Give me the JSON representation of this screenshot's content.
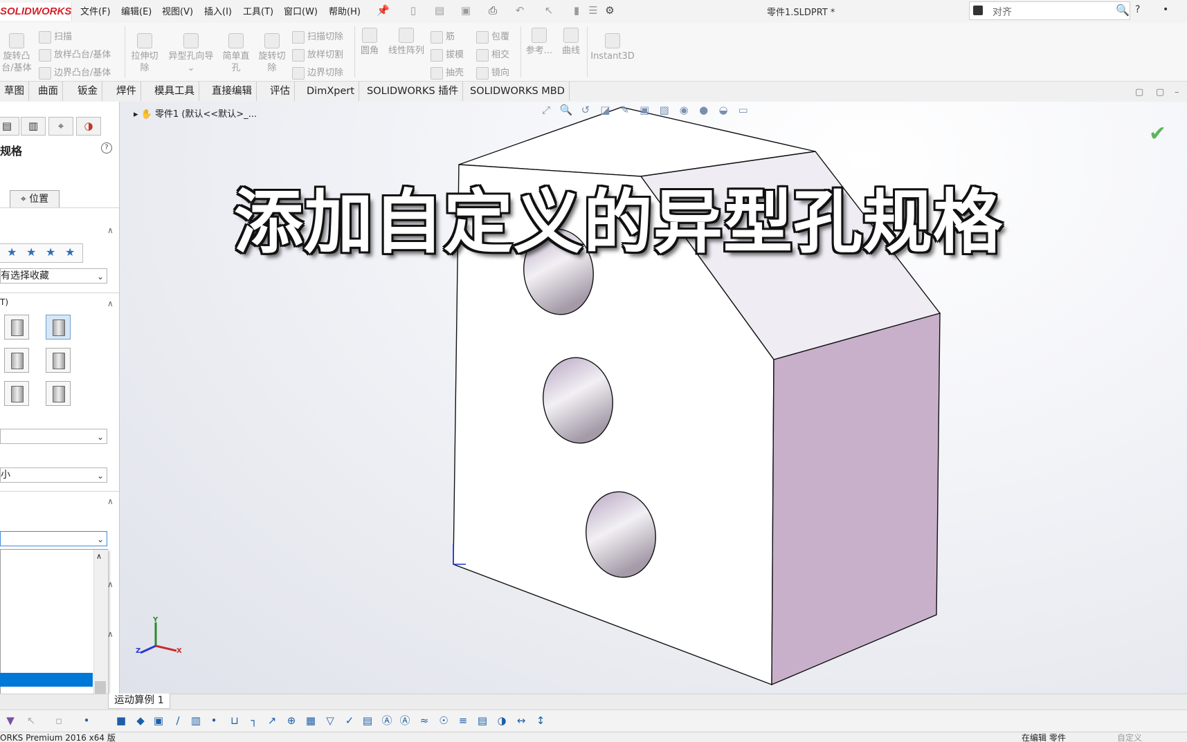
{
  "app": {
    "logo": "SOLIDWORKS",
    "document_title": "零件1.SLDPRT *"
  },
  "menu": [
    "文件(F)",
    "编辑(E)",
    "视图(V)",
    "插入(I)",
    "工具(T)",
    "窗口(W)",
    "帮助(H)"
  ],
  "search": {
    "scope": "对齐"
  },
  "commands": {
    "left_group": [
      "扫描",
      "放样凸台/基体",
      "边界凸台/基体"
    ],
    "revolve_boss": [
      "旋转凸",
      "台/基体"
    ],
    "extrude_cut": [
      "拉伸切",
      "除"
    ],
    "hole_wizard": "异型孔向导",
    "simple_hole": [
      "简单直",
      "孔"
    ],
    "revolve_cut": [
      "旋转切",
      "除"
    ],
    "cut_group": [
      "扫描切除",
      "放样切割",
      "边界切除"
    ],
    "fillet": "圆角",
    "linear_pattern": "线性阵列",
    "rib_group": [
      "筋",
      "拔模",
      "抽壳"
    ],
    "wrap_group": [
      "包覆",
      "相交",
      "镜向"
    ],
    "reference": "参考...",
    "curves": "曲线",
    "instant3d": "Instant3D"
  },
  "tabs": [
    "草图",
    "曲面",
    "钣金",
    "焊件",
    "模具工具",
    "直接编辑",
    "评估",
    "DimXpert",
    "SOLIDWORKS 插件",
    "SOLIDWORKS MBD"
  ],
  "property_manager": {
    "title": "规格",
    "position_tab": "位置",
    "favorite_combo": "有选择收藏",
    "hole_type_label": "T)",
    "size_combo": "小"
  },
  "feature_tree": {
    "flyout": "零件1 (默认<<默认>_..."
  },
  "overlay_title": "添加自定义的异型孔规格",
  "triad": {
    "x": "X",
    "y": "Y",
    "z": "Z"
  },
  "bottom": {
    "motion_tab": "运动算例 1"
  },
  "status": {
    "version": "ORKS Premium 2016 x64 版",
    "editing": "在编辑 零件",
    "custom": "自定义"
  }
}
